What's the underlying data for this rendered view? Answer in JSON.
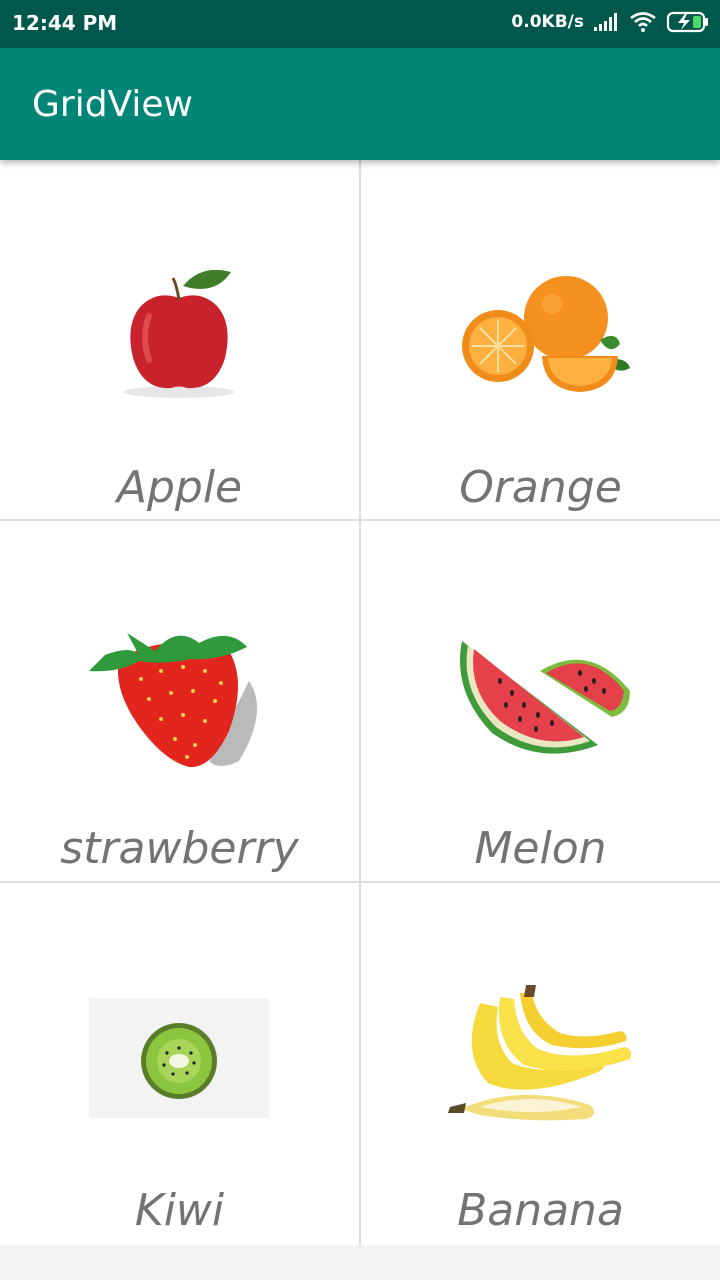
{
  "status_bar": {
    "time": "12:44 PM",
    "net_speed": "0.0KB/s",
    "icons": [
      "signal-icon",
      "wifi-icon",
      "battery-charging-icon"
    ]
  },
  "app_bar": {
    "title": "GridView"
  },
  "colors": {
    "status_bar": "#00574b",
    "app_bar": "#008577",
    "label_text": "#737373",
    "grid_line": "#dddddd"
  },
  "grid": {
    "items": [
      {
        "label": "Apple",
        "icon": "apple-icon"
      },
      {
        "label": "Orange",
        "icon": "orange-icon"
      },
      {
        "label": "strawberry",
        "icon": "strawberry-icon"
      },
      {
        "label": "Melon",
        "icon": "melon-icon"
      },
      {
        "label": "Kiwi",
        "icon": "kiwi-icon"
      },
      {
        "label": "Banana",
        "icon": "banana-icon"
      }
    ]
  }
}
